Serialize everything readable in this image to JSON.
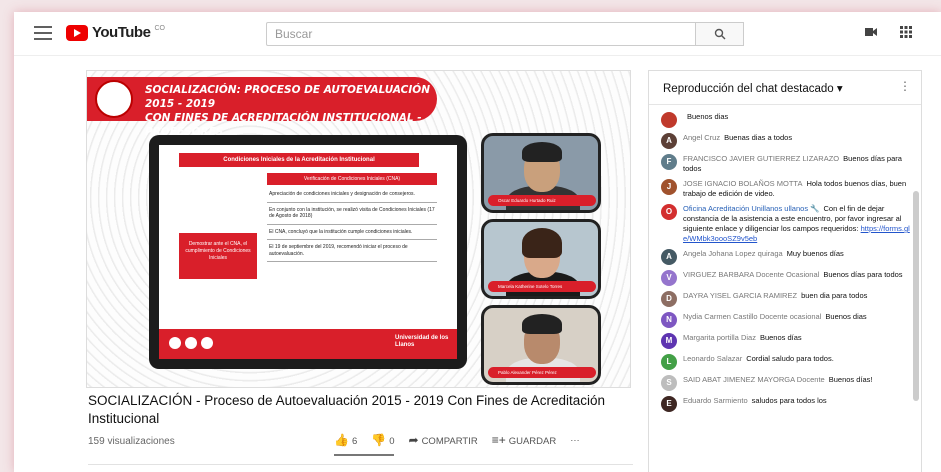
{
  "header": {
    "logo_text": "YouTube",
    "logo_region": "CO",
    "search_placeholder": "Buscar",
    "icons": [
      "menu-icon",
      "search-icon",
      "video-camera-icon",
      "apps-grid-icon"
    ]
  },
  "video": {
    "banner_lines": [
      "SOCIALIZACIÓN: PROCESO DE AUTOEVALUACIÓN 2015 - 2019",
      "CON FINES DE ACREDITACIÓN INSTITUCIONAL - PROFESORES"
    ],
    "slide": {
      "header": "Condiciones Iniciales de la Acreditación Institucional",
      "subheader": "Verificación de Condiciones Iniciales (CNA)",
      "left_box": "Demostrar ante el CNA, el cumplimiento de Condiciones Iniciales",
      "items": [
        "Apreciación de condiciones iniciales y designación de consejeros.",
        "En conjunto con la institución, se realizó visita de Condiciones Iniciales (17 de Agosto de 2018)",
        "El CNA, concluyó que la institución cumple condiciones iniciales.",
        "El 19 de septiembre del 2019, recomendó iniciar el proceso de autoevaluación."
      ],
      "footer_logo": "Universidad de los Llanos"
    },
    "cams": [
      {
        "name": "Oscar Eduardo Hurtado Ruiz"
      },
      {
        "name": "Marcela Katherine Sotelo Torres"
      },
      {
        "name": "Pablo Alexander Pérez Pérez"
      }
    ]
  },
  "meta": {
    "title": "SOCIALIZACIÓN - Proceso de Autoevaluación 2015 - 2019 Con Fines de Acreditación Institucional",
    "views": "159 visualizaciones",
    "likes": "6",
    "dislikes": "0",
    "share": "COMPARTIR",
    "save": "GUARDAR",
    "more": "···"
  },
  "chat": {
    "title": "Reproducción del chat destacado ▾",
    "messages": [
      {
        "initial": "",
        "color": "#c0392b",
        "author": "",
        "text": "Buenos dias",
        "owner": false
      },
      {
        "initial": "A",
        "color": "#5d4037",
        "author": "Angel Cruz",
        "text": "Buenas dias a todos",
        "owner": false
      },
      {
        "initial": "F",
        "color": "#607d8b",
        "author": "FRANCISCO JAVIER GUTIERREZ LIZARAZO",
        "text": "Buenos días para todos",
        "owner": false
      },
      {
        "initial": "J",
        "color": "#a0522d",
        "author": "JOSE IGNACIO BOLAÑOS MOTTA",
        "text": "Hola todos buenos días, buen trabajo de edición de video.",
        "owner": false
      },
      {
        "initial": "O",
        "color": "#d32f2f",
        "author": "Oficina Acreditación Unillanos ullanos 🔧",
        "text": "Con el fin de dejar constancia de la asistencia a este encuentro, por favor ingresar al siguiente enlace y diligenciar los campos requeridos:",
        "link": "https://forms.gl e/WMbk3oooSZ9v5eb",
        "owner": true
      },
      {
        "initial": "A",
        "color": "#455a64",
        "author": "Angela Johana Lopez quiraga",
        "text": "Muy buenos días",
        "owner": false
      },
      {
        "initial": "V",
        "color": "#9575cd",
        "author": "VIRGUEZ BARBARA Docente Ocasional",
        "text": "Buenos días para todos",
        "owner": false
      },
      {
        "initial": "D",
        "color": "#8d6e63",
        "author": "DAYRA YISEL GARCIA RAMIREZ",
        "text": "buen dia para todos",
        "owner": false
      },
      {
        "initial": "N",
        "color": "#7e57c2",
        "author": "Nydia Carmen Castillo Docente ocasional",
        "text": "Buenos dias",
        "owner": false
      },
      {
        "initial": "M",
        "color": "#5e35b1",
        "author": "Margarita portilla Diaz",
        "text": "Buenos días",
        "owner": false
      },
      {
        "initial": "L",
        "color": "#43a047",
        "author": "Leonardo Salazar",
        "text": "Cordial saludo para todos.",
        "owner": false
      },
      {
        "initial": "S",
        "color": "#bdbdbd",
        "author": "SAID ABAT JIMENEZ MAYORGA Docente",
        "text": "Buenos días!",
        "owner": false
      },
      {
        "initial": "E",
        "color": "#3e2723",
        "author": "Eduardo Sarmiento",
        "text": "saludos para todos los",
        "owner": false
      }
    ]
  }
}
